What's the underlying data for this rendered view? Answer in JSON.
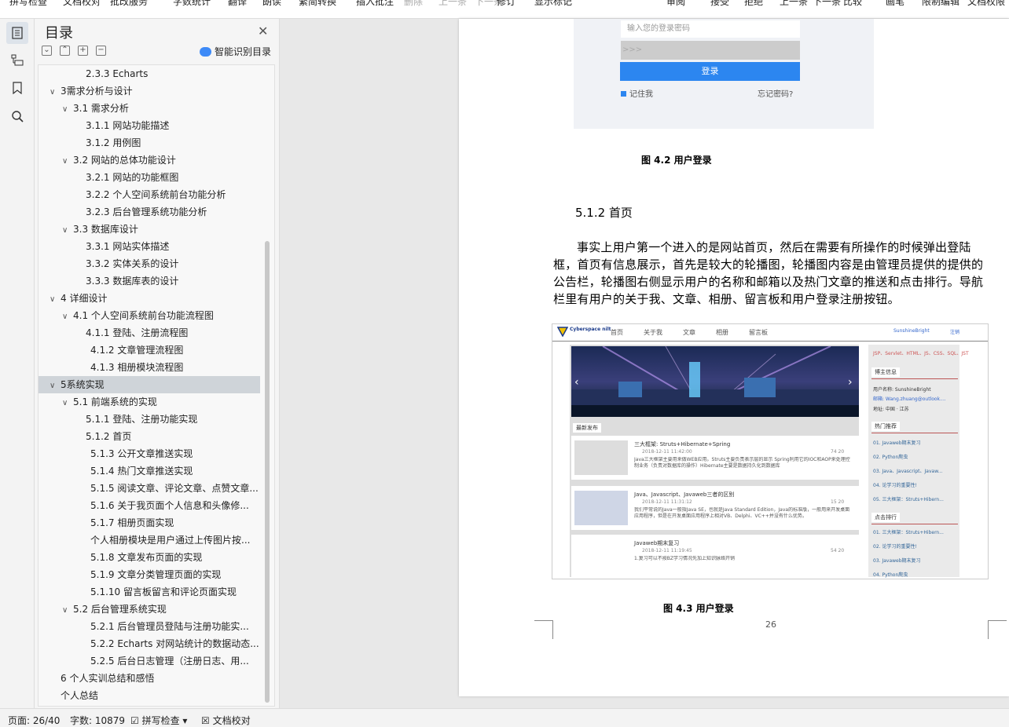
{
  "toolbar": {
    "items": [
      "拼写检查",
      "文档校对",
      "批改服务",
      "字数统计",
      "翻译",
      "朗读",
      "繁简转换",
      "插入批注",
      "删除",
      "上一条",
      "下一条",
      "修订",
      "显示标记",
      "审阅",
      "接受",
      "拒绝",
      "上一条",
      "下一条",
      "比较",
      "画笔",
      "限制编辑",
      "文档权限"
    ]
  },
  "toc": {
    "title": "目录",
    "smart_label": "智能识别目录",
    "items": [
      {
        "text": "2.3.3 Echarts",
        "level": 3,
        "toggle": ""
      },
      {
        "text": "3需求分析与设计",
        "level": 1,
        "toggle": "∨"
      },
      {
        "text": "3.1 需求分析",
        "level": 2,
        "toggle": "∨"
      },
      {
        "text": "3.1.1  网站功能描述",
        "level": 3,
        "toggle": ""
      },
      {
        "text": "3.1.2  用例图",
        "level": 3,
        "toggle": ""
      },
      {
        "text": "3.2  网站的总体功能设计",
        "level": 2,
        "toggle": "∨"
      },
      {
        "text": "3.2.1 网站的功能框图",
        "level": 3,
        "toggle": ""
      },
      {
        "text": "3.2.2 个人空间系统前台功能分析",
        "level": 3,
        "toggle": ""
      },
      {
        "text": "3.2.3 后台管理系统功能分析",
        "level": 3,
        "toggle": ""
      },
      {
        "text": "3.3 数据库设计",
        "level": 2,
        "toggle": "∨"
      },
      {
        "text": "3.3.1  网站实体描述",
        "level": 3,
        "toggle": ""
      },
      {
        "text": "3.3.2  实体关系的设计",
        "level": 3,
        "toggle": ""
      },
      {
        "text": "3.3.3  数据库表的设计",
        "level": 3,
        "toggle": ""
      },
      {
        "text": "4  详细设计",
        "level": 1,
        "toggle": "∨"
      },
      {
        "text": "4.1  个人空间系统前台功能流程图",
        "level": 2,
        "toggle": "∨"
      },
      {
        "text": "4.1.1  登陆、注册流程图",
        "level": 3,
        "toggle": ""
      },
      {
        "text": "4.1.2  文章管理流程图",
        "level": 4,
        "toggle": ""
      },
      {
        "text": "4.1.3  相册模块流程图",
        "level": 4,
        "toggle": ""
      },
      {
        "text": "5系统实现",
        "level": 1,
        "toggle": "∨",
        "selected": true
      },
      {
        "text": "5.1  前端系统的实现",
        "level": 2,
        "toggle": "∨"
      },
      {
        "text": "5.1.1  登陆、注册功能实现",
        "level": 3,
        "toggle": ""
      },
      {
        "text": "5.1.2  首页",
        "level": 3,
        "toggle": ""
      },
      {
        "text": "5.1.3  公开文章推送实现",
        "level": 4,
        "toggle": ""
      },
      {
        "text": "5.1.4  热门文章推送实现",
        "level": 4,
        "toggle": ""
      },
      {
        "text": "5.1.5  阅读文章、评论文章、点赞文章...",
        "level": 4,
        "toggle": ""
      },
      {
        "text": "5.1.6  关于我页面个人信息和头像修...",
        "level": 4,
        "toggle": ""
      },
      {
        "text": "5.1.7  相册页面实现",
        "level": 4,
        "toggle": ""
      },
      {
        "text": "个人相册模块是用户通过上传图片按...",
        "level": 4,
        "toggle": ""
      },
      {
        "text": "5.1.8  文章发布页面的实现",
        "level": 4,
        "toggle": ""
      },
      {
        "text": "5.1.9  文章分类管理页面的实现",
        "level": 4,
        "toggle": ""
      },
      {
        "text": "5.1.10  留言板留言和评论页面实现",
        "level": 4,
        "toggle": ""
      },
      {
        "text": "5.2  后台管理系统实现",
        "level": 2,
        "toggle": "∨"
      },
      {
        "text": "5.2.1  后台管理员登陆与注册功能实...",
        "level": 4,
        "toggle": ""
      },
      {
        "text": "5.2.2 Echarts 对网站统计的数据动态...",
        "level": 4,
        "toggle": ""
      },
      {
        "text": "5.2.5  后台日志管理（注册日志、用...",
        "level": 4,
        "toggle": ""
      },
      {
        "text": "6  个人实训总结和感悟",
        "level": 1,
        "toggle": ""
      },
      {
        "text": "个人总结",
        "level": 1,
        "toggle": ""
      }
    ]
  },
  "page": {
    "login": {
      "password_placeholder": "输入您的登录密码",
      "arrows": ">>>",
      "button": "登录",
      "remember": "记住我",
      "forgot": "忘记密码?"
    },
    "caption1": "图 4.2  用户登录",
    "heading": "5.1.2  首页",
    "paragraph": "事实上用户第一个进入的是网站首页，然后在需要有所操作的时候弹出登陆框，首页有信息展示，首先是较大的轮播图，轮播图内容是由管理员提供的提供的公告栏，轮播图右侧显示用户的名称和邮箱以及热门文章的推送和点击排行。导航栏里有用户的关于我、文章、相册、留言板和用户登录注册按钮。",
    "caption2": "图 4.3  用户登录",
    "page_number": "26",
    "shot": {
      "brand": "Cyberspace nilt",
      "nav": [
        "首页",
        "关于我",
        "文章",
        "相册",
        "留言板"
      ],
      "user": "SunshineBright",
      "logout": "注销",
      "skills": "JSP、Servlet、HTML、JS、CSS、SQL、JST",
      "sec_blogger": "博主信息",
      "blogger_name": "用户名称: SunshineBright",
      "blogger_mail": "邮箱: Wang.zhuang@outlook....",
      "blogger_loc": "地址: 中国 · 江苏",
      "sec_latest": "最新发布",
      "sec_hot": "热门推荐",
      "sec_click": "点击排行",
      "posts": [
        {
          "title": "三大框架: Struts+Hibernate+Spring",
          "date": "2018-12-11 11:42:00",
          "summary": "Java三大框架主要用来做WEB应用。Struts主要负责表示层的显示 Spring利用它的IOC和AOP来处理控制业务（负责对数据库的操作）Hibernate主要是数据持久化到数据库",
          "stats": "74  20"
        },
        {
          "title": "Java、Javascript、Javaweb三者的区别",
          "date": "2018-12-11 11:31:12",
          "summary": "我们平常说的Java一般指Java SE，也就是Java Standard Edition，Java的标准版，一般用来开发桌面应用程序，但是在开发桌面应用程序上相对VB、Delphi、VC++并没有什么优势。",
          "stats": "15  20"
        },
        {
          "title": "Javaweb期末复习",
          "date": "2018-12-11 11:19:45",
          "summary": "1.复习可以不按BZ学习情况先加上知识脉络开销",
          "stats": "54  20"
        }
      ],
      "hot": [
        "01. Javaweb期末复习",
        "02. Python爬虫",
        "03. Java、Javascript、Javaw...",
        "04. 论学习的重要性!",
        "05. 三大框架：Struts+Hibern..."
      ],
      "click": [
        "01. 三大框架：Struts+Hibern...",
        "02. 论学习的重要性!",
        "03. Javaweb期末复习",
        "04. Python爬虫"
      ]
    }
  },
  "status": {
    "page": "页面: 26/40",
    "words": "字数: 10879",
    "spell": "拼写检查",
    "proof": "文档校对"
  },
  "colors": {
    "accent": "#2c86f0",
    "selected": "#cfd4d9"
  }
}
